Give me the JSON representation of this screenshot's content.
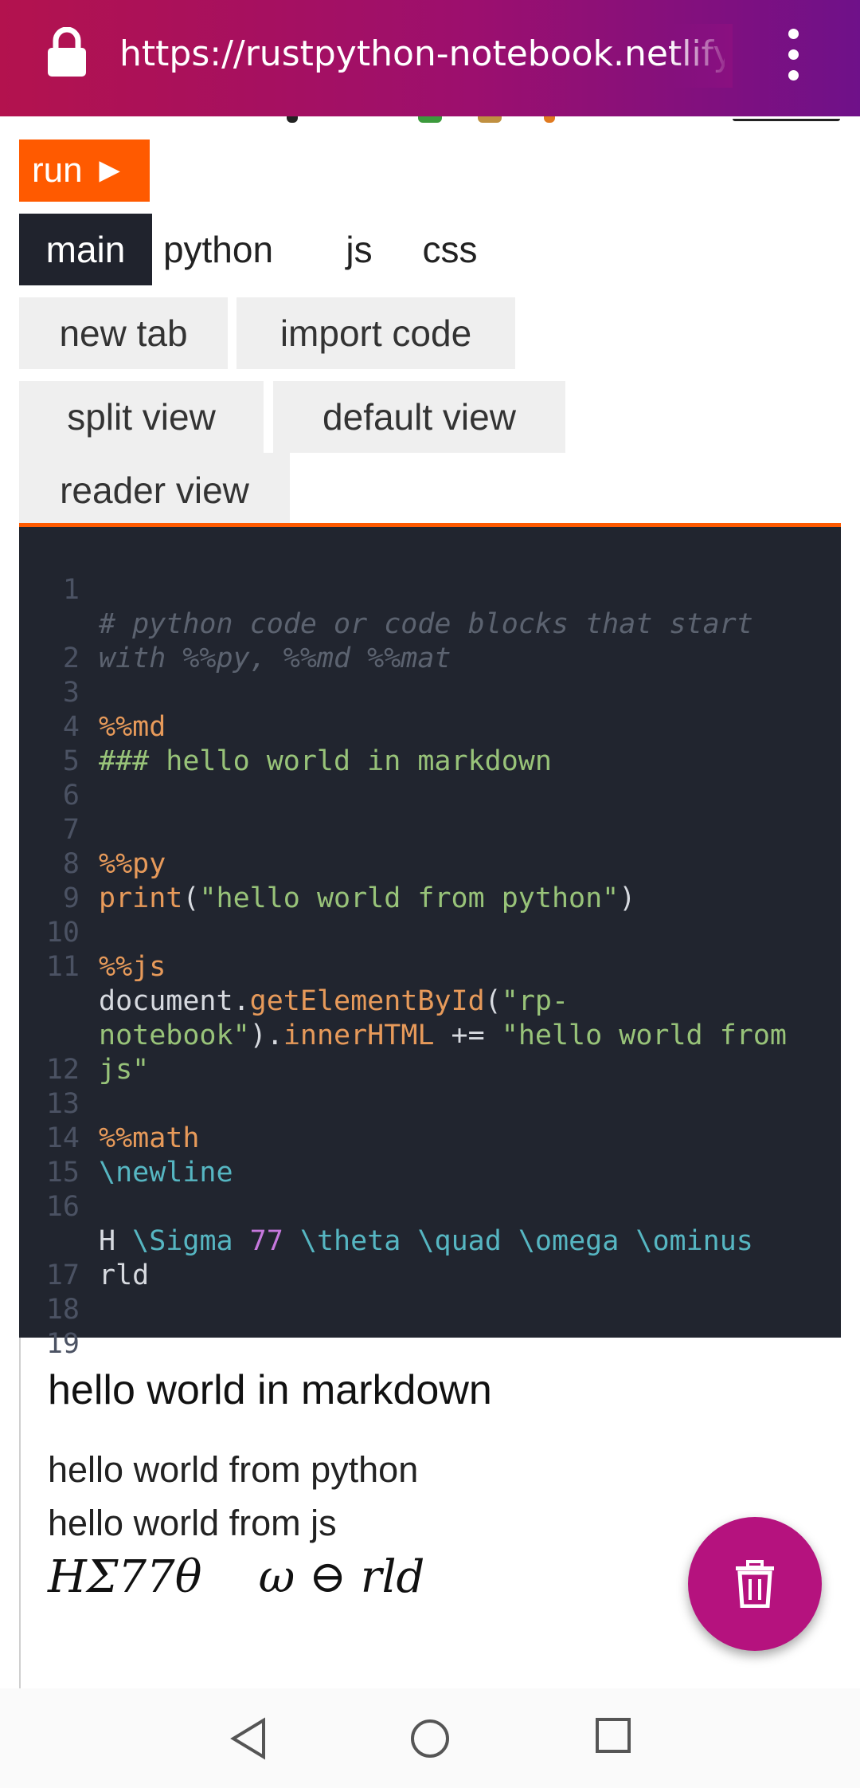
{
  "browser": {
    "url": "https://rustpython-notebook.netlify.ap",
    "icons": [
      "lock-icon",
      "more-vert-icon"
    ]
  },
  "toolbar": {
    "run_label": "run ►"
  },
  "tabs": [
    {
      "label": "main",
      "active": true
    },
    {
      "label": "python",
      "active": false
    },
    {
      "label": "js",
      "active": false
    },
    {
      "label": "css",
      "active": false
    }
  ],
  "buttons": {
    "new_tab": "new tab",
    "import_code": "import code",
    "split_view": "split view",
    "default_view": "default view",
    "reader_view": "reader view"
  },
  "editor": {
    "lines": [
      {
        "n": "1",
        "text": "# python code or code blocks that start"
      },
      {
        "n": "",
        "text": "with %%py, %%md %%mat"
      },
      {
        "n": "2",
        "text": ""
      },
      {
        "n": "3",
        "text": "%%md"
      },
      {
        "n": "4",
        "text": "### hello world in markdown"
      },
      {
        "n": "5",
        "text": ""
      },
      {
        "n": "6",
        "text": ""
      },
      {
        "n": "7",
        "text": "%%py"
      },
      {
        "n": "8",
        "tokens": [
          "print",
          "(",
          "\"hello world from python\"",
          ")"
        ]
      },
      {
        "n": "9",
        "text": ""
      },
      {
        "n": "10",
        "text": "%%js"
      },
      {
        "n": "11",
        "tokens": [
          "document.",
          "getElementById",
          "(",
          "\"rp-"
        ]
      },
      {
        "n": "",
        "tokens": [
          "notebook\"",
          ").",
          "innerHTML",
          " += ",
          "\"hello world from"
        ]
      },
      {
        "n": "",
        "text": "js\""
      },
      {
        "n": "12",
        "text": ""
      },
      {
        "n": "13",
        "text": "%%math"
      },
      {
        "n": "14",
        "text": "\\newline"
      },
      {
        "n": "15",
        "text": ""
      },
      {
        "n": "16",
        "tokens": [
          "H ",
          "\\Sigma",
          " ",
          "77",
          " ",
          "\\theta",
          " ",
          "\\quad",
          " ",
          "\\omega",
          " ",
          "\\ominus"
        ]
      },
      {
        "n": "",
        "text": "rld"
      },
      {
        "n": "17",
        "text": ""
      },
      {
        "n": "18",
        "text": ""
      },
      {
        "n": "19",
        "text": ""
      }
    ]
  },
  "output": {
    "heading": "hello world in markdown",
    "python_line": "hello world from python",
    "js_line": "hello world from js",
    "math_line": "HΣ77θ    ω ⊖ rld"
  },
  "fab": {
    "icon": "trash-icon"
  },
  "navbar": {
    "icons": [
      "back-icon",
      "home-icon",
      "recents-icon"
    ]
  },
  "colors": {
    "accent": "#ff5a00",
    "editor_bg": "#21252f",
    "fab": "#b5127e"
  }
}
